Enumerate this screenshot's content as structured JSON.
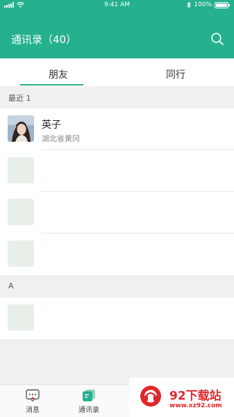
{
  "status_bar": {
    "time": "9:41 AM",
    "battery": "100%",
    "battery_level": 1.0
  },
  "header": {
    "title": "通讯录（40）",
    "search_icon": "search-icon"
  },
  "tabs": [
    {
      "label": "朋友",
      "active": true
    },
    {
      "label": "同行",
      "active": false
    }
  ],
  "sections": [
    {
      "header": "最近 1",
      "contacts": [
        {
          "name": "英子",
          "location": "湖北省黄冈"
        },
        {
          "name": "",
          "location": ""
        },
        {
          "name": "",
          "location": ""
        },
        {
          "name": "",
          "location": ""
        }
      ]
    },
    {
      "header": "A",
      "contacts": [
        {
          "name": "",
          "location": ""
        }
      ]
    }
  ],
  "tab_bar": [
    {
      "label": "消息",
      "icon": "chat-icon"
    },
    {
      "label": "通讯录",
      "icon": "contacts-icon",
      "active": true
    }
  ],
  "watermark": {
    "brand": "92下载站",
    "url": "www.xz92.com"
  },
  "colors": {
    "accent": "#25b08e",
    "background": "#f0f0f0",
    "watermark_red": "#e0282b"
  }
}
